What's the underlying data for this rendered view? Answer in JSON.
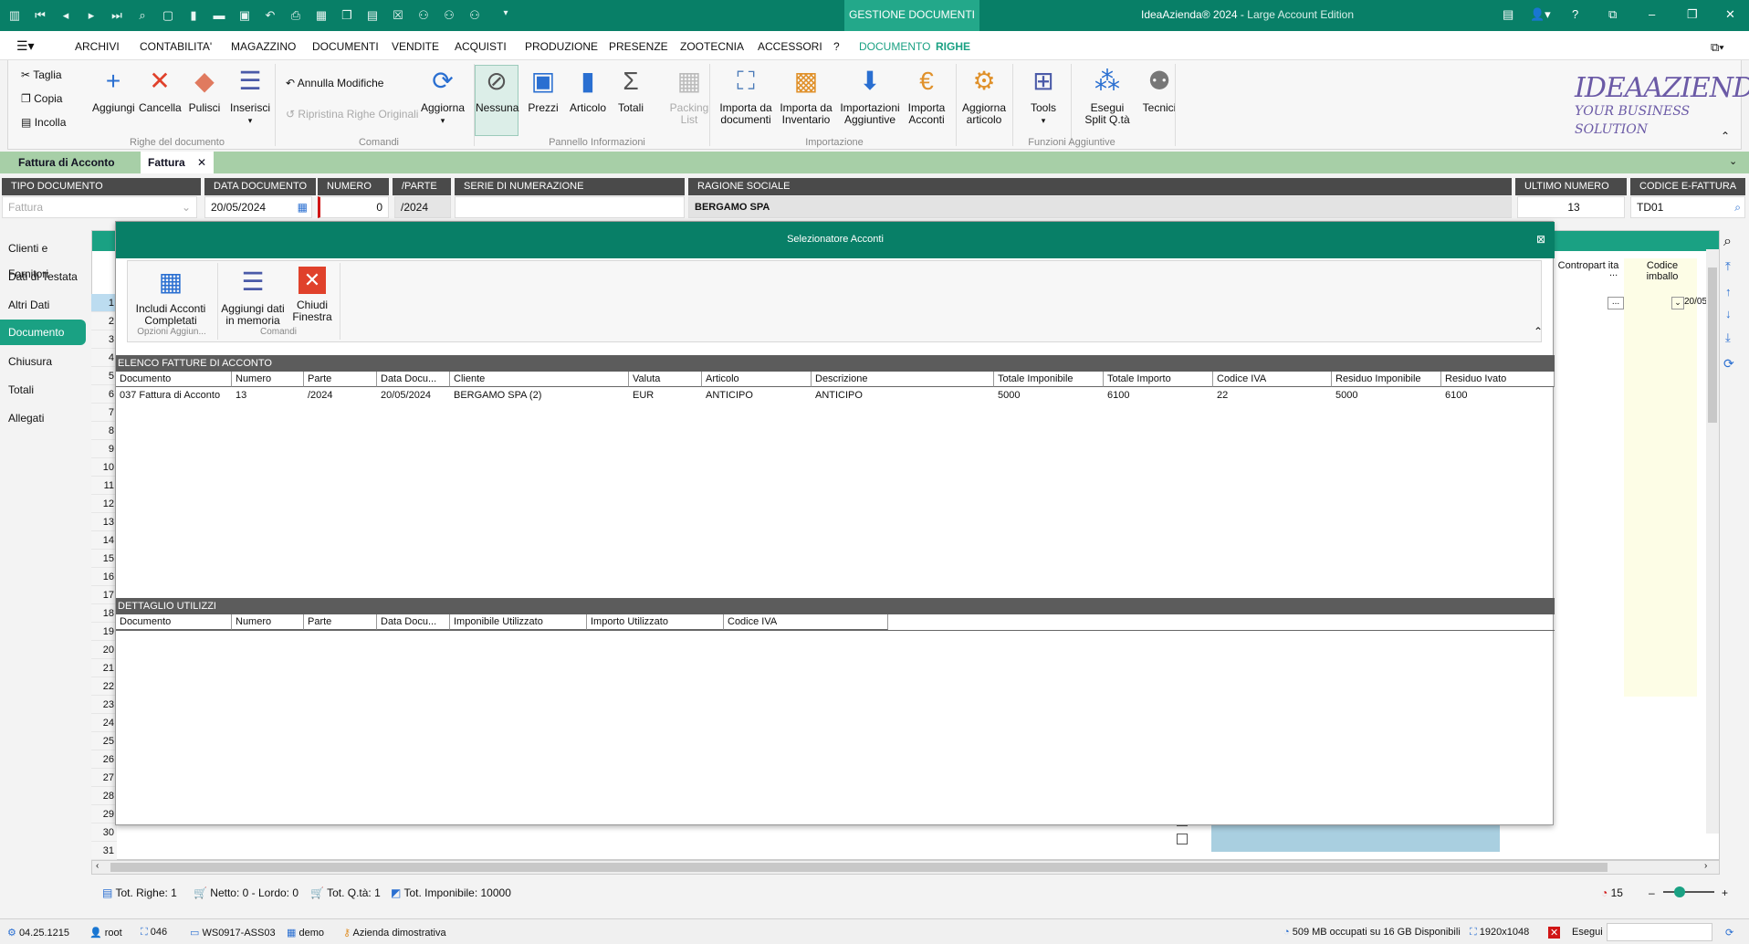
{
  "titlebar": {
    "context_tab": "GESTIONE DOCUMENTI",
    "app_name": "IdeaAzienda® 2024",
    "edition": "Large Account Edition"
  },
  "menu": [
    "ARCHIVI",
    "CONTABILITA'",
    "MAGAZZINO",
    "DOCUMENTI",
    "VENDITE",
    "ACQUISTI",
    "PRODUZIONE",
    "PRESENZE",
    "ZOOTECNIA",
    "ACCESSORI",
    "?",
    "DOCUMENTO",
    "RIGHE"
  ],
  "ribbon": {
    "clipboard": {
      "cut": "Taglia",
      "copy": "Copia",
      "paste": "Incolla"
    },
    "rows": {
      "add": "Aggiungi",
      "delete": "Cancella",
      "clean": "Pulisci",
      "insert": "Inserisci",
      "group": "Righe del documento"
    },
    "commands": {
      "undo": "Annulla Modifiche",
      "restore": "Ripristina Righe Originali",
      "refresh": "Aggiorna",
      "group": "Comandi"
    },
    "info": {
      "none": "Nessuna",
      "prices": "Prezzi",
      "article": "Articolo",
      "totals": "Totali",
      "packing1": "Packing",
      "packing2": "List",
      "group": "Pannello Informazioni"
    },
    "import": {
      "from_docs1": "Importa da",
      "from_docs2": "documenti",
      "from_inv1": "Importa da",
      "from_inv2": "Inventario",
      "extra1": "Importazioni",
      "extra2": "Aggiuntive",
      "advances1": "Importa",
      "advances2": "Acconti",
      "group": "Importazione"
    },
    "extra": {
      "update1": "Aggiorna",
      "update2": "articolo",
      "tools": "Tools",
      "split1": "Esegui",
      "split2": "Split Q.tà",
      "tech": "Tecnici",
      "group": "Funzioni Aggiuntive"
    },
    "logo1": "IDEAAZIENDA",
    "logo2": "YOUR BUSINESS SOLUTION"
  },
  "doc_tabs": {
    "t1": "Fattura di Acconto",
    "t2": "Fattura"
  },
  "header": {
    "tipo_label": "TIPO DOCUMENTO",
    "tipo_value": "Fattura",
    "data_label": "DATA DOCUMENTO",
    "data_value": "20/05/2024",
    "numero_label": "NUMERO",
    "numero_value": "0",
    "parte_label": "/PARTE",
    "parte_value": "/2024",
    "serie_label": "SERIE DI NUMERAZIONE",
    "serie_value": "",
    "ragione_label": "RAGIONE SOCIALE",
    "ragione_value": "BERGAMO SPA",
    "ultimo_label": "ULTIMO NUMERO",
    "ultimo_value": "13",
    "efatt_label": "CODICE E-FATTURA",
    "efatt_value": "TD01"
  },
  "nav": [
    "Clienti e Fornitori",
    "Dati di Testata",
    "Altri Dati",
    "Documento",
    "Chiusura",
    "Totali",
    "Allegati"
  ],
  "bg_grid": {
    "col1": "Contropart ita",
    "col2": "...",
    "col3": "Codice imballo",
    "cell_date": "20/05",
    "ellipsis": "..."
  },
  "dialog": {
    "title": "Selezionatore Acconti",
    "btn_include1": "Includi Acconti",
    "btn_include2": "Completati",
    "btn_add1": "Aggiungi dati",
    "btn_add2": "in memoria",
    "btn_close1": "Chiudi",
    "btn_close2": "Finestra",
    "grp1": "Opzioni Aggiun...",
    "grp2": "Comandi",
    "sec1": "ELENCO FATTURE DI ACCONTO",
    "sec2": "DETTAGLIO UTILIZZI",
    "cols1": [
      "Documento",
      "Numero",
      "Parte",
      "Data Docu...",
      "Cliente",
      "Valuta",
      "Articolo",
      "Descrizione",
      "Totale Imponibile",
      "Totale Importo",
      "Codice IVA",
      "Residuo Imponibile",
      "Residuo Ivato"
    ],
    "row1": [
      "037 Fattura di Acconto",
      "13",
      "/2024",
      "20/05/2024",
      "BERGAMO SPA (2)",
      "EUR",
      "ANTICIPO",
      "ANTICIPO",
      "5000",
      "6100",
      "22",
      "5000",
      "6100"
    ],
    "cols2": [
      "Documento",
      "Numero",
      "Parte",
      "Data Docu...",
      "Imponibile Utilizzato",
      "Importo Utilizzato",
      "Codice IVA"
    ]
  },
  "row_numbers": [
    "1",
    "2",
    "3",
    "4",
    "5",
    "6",
    "7",
    "8",
    "9",
    "10",
    "11",
    "12",
    "13",
    "14",
    "15",
    "16",
    "17",
    "18",
    "19",
    "20",
    "21",
    "22",
    "23",
    "24",
    "25",
    "26",
    "27",
    "28",
    "29",
    "30",
    "31"
  ],
  "totals": {
    "righe": "Tot. Righe: 1",
    "netto": "Netto: 0 - Lordo: 0",
    "qta": "Tot. Q.tà: 1",
    "imponibile": "Tot. Imponibile: 10000",
    "count": "15"
  },
  "status": {
    "version": "04.25.1215",
    "user": "root",
    "code": "046",
    "host": "WS0917-ASS03",
    "db": "demo",
    "company": "Azienda dimostrativa",
    "memory": "509 MB occupati su 16 GB Disponibili",
    "resolution": "1920x1048",
    "exec": "Esegui"
  }
}
